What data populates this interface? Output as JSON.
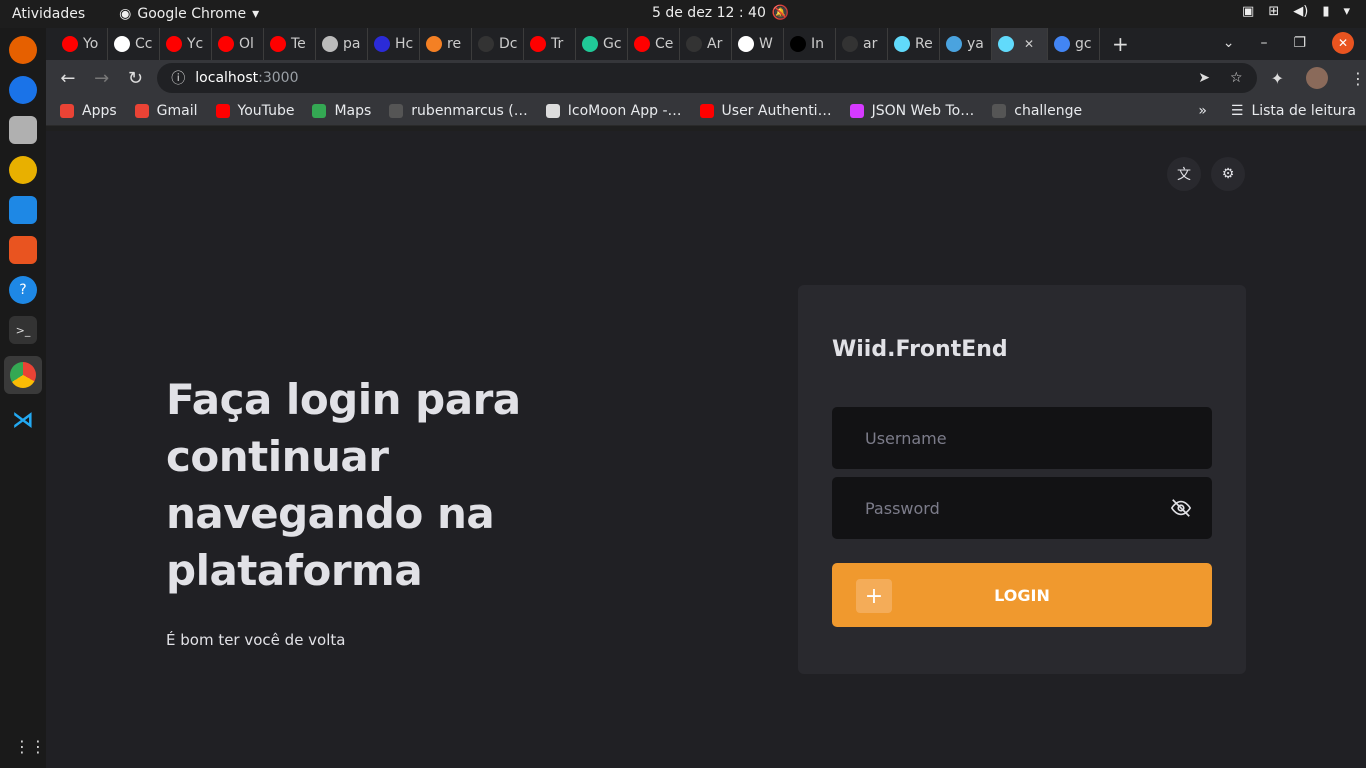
{
  "system": {
    "activities": "Atividades",
    "app_name": "Google Chrome",
    "clock": "5 de dez  12 : 40"
  },
  "tabs": [
    {
      "label": "Yo",
      "color": "#ff0000"
    },
    {
      "label": "Cc",
      "color": "#ffffff"
    },
    {
      "label": "Yc",
      "color": "#ff0000"
    },
    {
      "label": "Ol",
      "color": "#ff0000"
    },
    {
      "label": "Te",
      "color": "#ff0000"
    },
    {
      "label": "pa",
      "color": "#bbbbbb"
    },
    {
      "label": "Hc",
      "color": "#2b2bd8"
    },
    {
      "label": "re",
      "color": "#f48024"
    },
    {
      "label": "Dc",
      "color": "#333333"
    },
    {
      "label": "Tr",
      "color": "#ff0000"
    },
    {
      "label": "Gc",
      "color": "#20c997"
    },
    {
      "label": "Ce",
      "color": "#ff0000"
    },
    {
      "label": "Ar",
      "color": "#333333"
    },
    {
      "label": "W",
      "color": "#ffffff"
    },
    {
      "label": "In",
      "color": "#000000"
    },
    {
      "label": "ar",
      "color": "#333333"
    },
    {
      "label": "Re",
      "color": "#61dafb"
    },
    {
      "label": "ya",
      "color": "#4aa3df"
    },
    {
      "label": "",
      "color": "#61dafb",
      "active": true
    },
    {
      "label": "gc",
      "color": "#4285f4"
    }
  ],
  "address": {
    "host": "localhost",
    "port": ":3000"
  },
  "bookmarks": [
    {
      "label": "Apps",
      "color": "#ea4335"
    },
    {
      "label": "Gmail",
      "color": "#ea4335"
    },
    {
      "label": "YouTube",
      "color": "#ff0000"
    },
    {
      "label": "Maps",
      "color": "#34a853"
    },
    {
      "label": "rubenmarcus (…",
      "color": "#555555"
    },
    {
      "label": "IcoMoon App -…",
      "color": "#dddddd"
    },
    {
      "label": "User Authenti…",
      "color": "#ff0000"
    },
    {
      "label": "JSON Web To…",
      "color": "#d63aff"
    },
    {
      "label": "challenge",
      "color": "#555555"
    }
  ],
  "reading_list": "Lista de leitura",
  "page": {
    "headline": "Faça login para continuar navegando na plataforma",
    "subtitle": "É bom ter você de volta",
    "brand": "Wiid.FrontEnd",
    "username_placeholder": "Username",
    "password_placeholder": "Password",
    "login_label": "LOGIN"
  },
  "colors": {
    "accent": "#f0992e",
    "card": "#29292e",
    "input": "#121214",
    "background": "#202024"
  }
}
